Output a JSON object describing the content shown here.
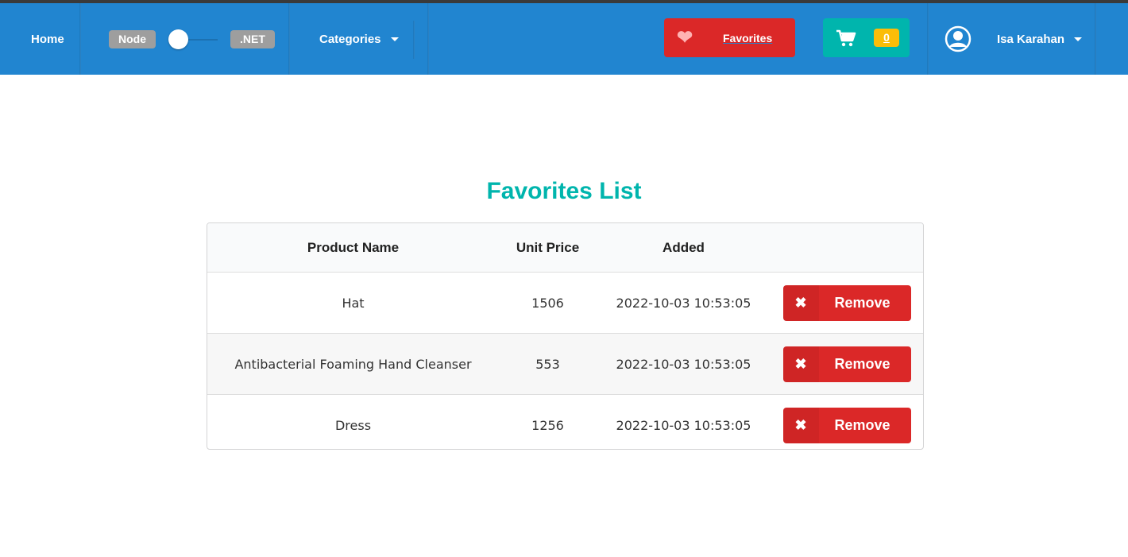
{
  "nav": {
    "home": "Home",
    "toggle_left": "Node",
    "toggle_right": ".NET",
    "categories": "Categories",
    "favorites": "Favorites",
    "cart_count": "0",
    "username": "Isa Karahan"
  },
  "title": "Favorites List",
  "table": {
    "headers": [
      "Product Name",
      "Unit Price",
      "Added",
      ""
    ],
    "rows": [
      {
        "name": "Hat",
        "price": "1506",
        "added": "2022-10-03 10:53:05",
        "action": "Remove"
      },
      {
        "name": "Antibacterial Foaming Hand Cleanser",
        "price": "553",
        "added": "2022-10-03 10:53:05",
        "action": "Remove"
      },
      {
        "name": "Dress",
        "price": "1256",
        "added": "2022-10-03 10:53:05",
        "action": "Remove"
      }
    ]
  },
  "colors": {
    "nav": "#2185d0",
    "red": "#db2828",
    "teal": "#00b5ad",
    "yellow": "#fbbd08"
  }
}
